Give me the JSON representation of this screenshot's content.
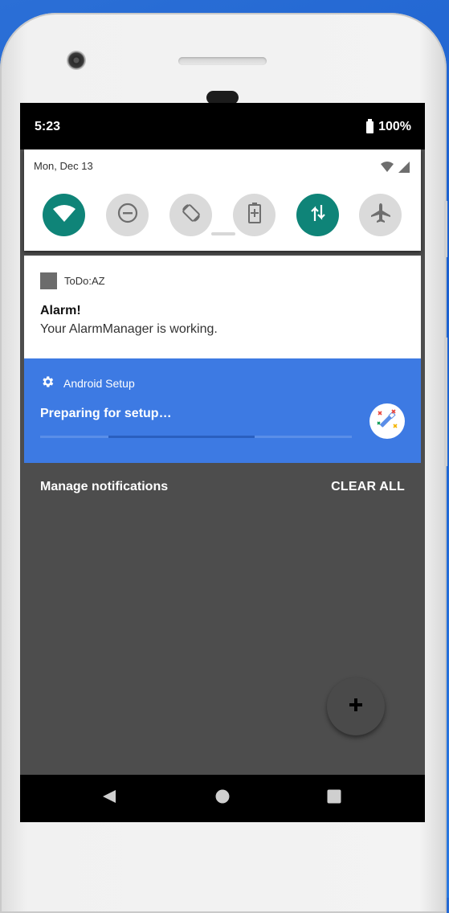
{
  "status_bar": {
    "time": "5:23",
    "battery": "100%"
  },
  "quick_settings": {
    "date": "Mon, Dec 13",
    "tiles": [
      {
        "icon": "wifi-icon",
        "active": true
      },
      {
        "icon": "do-not-disturb-icon",
        "active": false
      },
      {
        "icon": "auto-rotate-icon",
        "active": false
      },
      {
        "icon": "battery-saver-icon",
        "active": false
      },
      {
        "icon": "mobile-data-icon",
        "active": true
      },
      {
        "icon": "airplane-mode-icon",
        "active": false
      }
    ]
  },
  "notifications": {
    "todo": {
      "app_name": "ToDo:AZ",
      "title": "Alarm!",
      "text": "Your AlarmManager is working."
    },
    "setup": {
      "app_name": "Android Setup",
      "title": "Preparing for setup…",
      "icon": "magic-wand-icon",
      "progress": "indeterminate"
    }
  },
  "actions": {
    "manage": "Manage notifications",
    "clear_all": "CLEAR ALL"
  },
  "fab": {
    "icon": "plus-icon"
  },
  "nav_bar": {
    "back": "back-icon",
    "home": "home-icon",
    "recents": "recents-icon"
  },
  "colors": {
    "accent_teal": "#0f8478",
    "setup_blue": "#3d7ae3",
    "shade_bg": "#4d4d4d"
  }
}
